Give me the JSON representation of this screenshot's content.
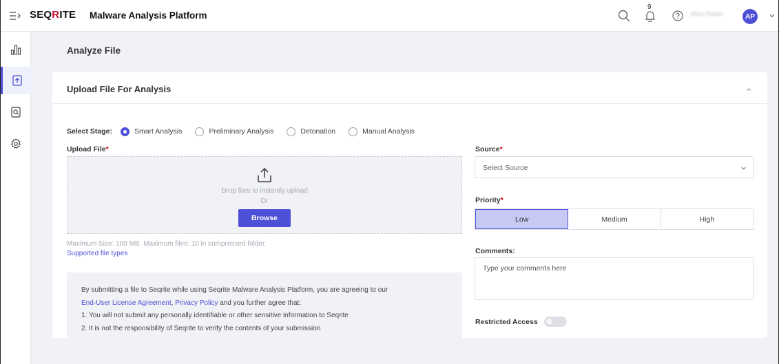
{
  "header": {
    "logo_prefix": "SEQ",
    "logo_q": "R",
    "logo_suffix": "ITE",
    "app_title": "Malware Analysis Platform",
    "notification_count": "9",
    "user_name": "Afsha Pathan",
    "avatar_initials": "AP"
  },
  "sidebar": {
    "items": [
      {
        "icon": "bar-chart-icon"
      },
      {
        "icon": "file-upload-icon",
        "active": true
      },
      {
        "icon": "file-search-icon"
      },
      {
        "icon": "settings-icon"
      }
    ]
  },
  "page": {
    "title": "Analyze File"
  },
  "upload_card": {
    "title": "Upload File For Analysis",
    "stage_label": "Select Stage:",
    "stages": [
      {
        "label": "Smart Analysis",
        "selected": true
      },
      {
        "label": "Preliminary Analysis",
        "selected": false
      },
      {
        "label": "Detonation",
        "selected": false
      },
      {
        "label": "Manual Analysis",
        "selected": false
      }
    ],
    "upload_label": "Upload File",
    "required_mark": "*",
    "drop_text": "Drop files to instantly upload",
    "or_text": "Or",
    "browse_label": "Browse",
    "max_size_text": "Maximum Size: 100 MB, Maximum files: 10 in compressed folder.",
    "supported_link": "Supported file types",
    "terms": {
      "line1": "By submitting a file to Seqrite while using Seqrite Malware Analysis Platform, you are agreeing to our",
      "eula_link": "End-User License Agreement",
      "comma": ", ",
      "privacy_link": "Privacy Policy",
      "line2_rest": " and you further agree that:",
      "item1": "1. You will not submit any personally identifiable or other sensitive information to Seqrite",
      "item2": "2. It is not the responsibility of Seqrite to verify the contents of your submission"
    },
    "source_label": "Source",
    "source_placeholder": "Select Source",
    "priority_label": "Priority",
    "priorities": [
      {
        "label": "Low",
        "selected": true
      },
      {
        "label": "Medium",
        "selected": false
      },
      {
        "label": "High",
        "selected": false
      }
    ],
    "comments_label": "Comments:",
    "comments_placeholder": "Type your comments here",
    "restricted_label": "Restricted Access",
    "restricted_enabled": false
  },
  "colors": {
    "accent": "#4d4fd6",
    "brand_red": "#c8102e",
    "required": "#d0021b"
  }
}
